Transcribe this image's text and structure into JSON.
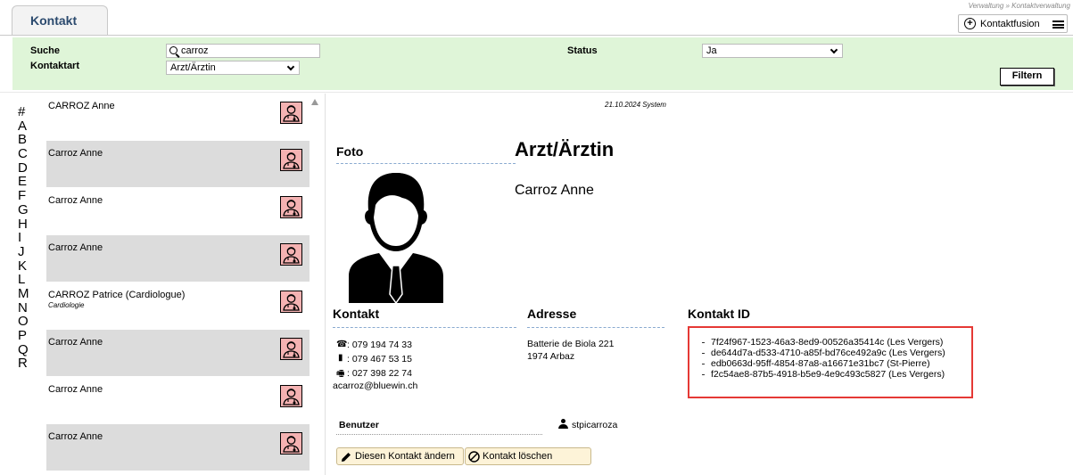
{
  "header": {
    "tab_label": "Kontakt",
    "breadcrumb": "Verwaltung » Kontaktverwaltung",
    "fusion_label": "Kontaktfusion"
  },
  "filters": {
    "search_label": "Suche",
    "search_value": "carroz",
    "kontaktart_label": "Kontaktart",
    "kontaktart_value": "Arzt/Ärztin",
    "status_label": "Status",
    "status_value": "Ja",
    "filter_button": "Filtern"
  },
  "alphabet": [
    "#",
    "A",
    "B",
    "C",
    "D",
    "E",
    "F",
    "G",
    "H",
    "I",
    "J",
    "K",
    "L",
    "M",
    "N",
    "O",
    "P",
    "Q",
    "R"
  ],
  "list": [
    {
      "name": "CARROZ Anne",
      "sub": "",
      "alt": false
    },
    {
      "name": "Carroz Anne",
      "sub": "",
      "alt": true
    },
    {
      "name": "Carroz Anne",
      "sub": "",
      "alt": false
    },
    {
      "name": "Carroz Anne",
      "sub": "",
      "alt": true
    },
    {
      "name": "CARROZ Patrice (Cardiologue)",
      "sub": "Cardiologie",
      "alt": false
    },
    {
      "name": "Carroz Anne",
      "sub": "",
      "alt": true
    },
    {
      "name": "Carroz Anne",
      "sub": "",
      "alt": false
    },
    {
      "name": "Carroz Anne",
      "sub": "",
      "alt": true
    }
  ],
  "detail": {
    "stamp": "21.10.2024 System",
    "foto_label": "Foto",
    "type_title": "Arzt/Ärztin",
    "name": "Carroz Anne",
    "kontakt_label": "Kontakt",
    "phone": ": 079 194 74 33",
    "mobile": ": 079 467 53 15",
    "fax": ": 027 398 22 74",
    "email": "acarroz@bluewin.ch",
    "adresse_label": "Adresse",
    "street": "Batterie de Biola 221",
    "city": "1974 Arbaz",
    "kontakt_id_label": "Kontakt ID",
    "ids": [
      "7f24f967-1523-46a3-8ed9-00526a35414c (Les Vergers)",
      "de644d7a-d533-4710-a85f-bd76ce492a9c (Les Vergers)",
      "edb0663d-95ff-4854-87a8-a16671e31bc7 (St-Pierre)",
      "f2c54ae8-87b5-4918-b5e9-4e9c493c5827 (Les Vergers)"
    ],
    "benutzer_label": "Benutzer",
    "benutzer_value": "stpicarroza",
    "edit_button": "Diesen Kontakt ändern",
    "delete_button": "Kontakt löschen"
  },
  "icons": {
    "doctor_badge_bg": "#f4b2b2",
    "id_box_border": "#e53935",
    "filter_bg": "#dff5d8"
  }
}
